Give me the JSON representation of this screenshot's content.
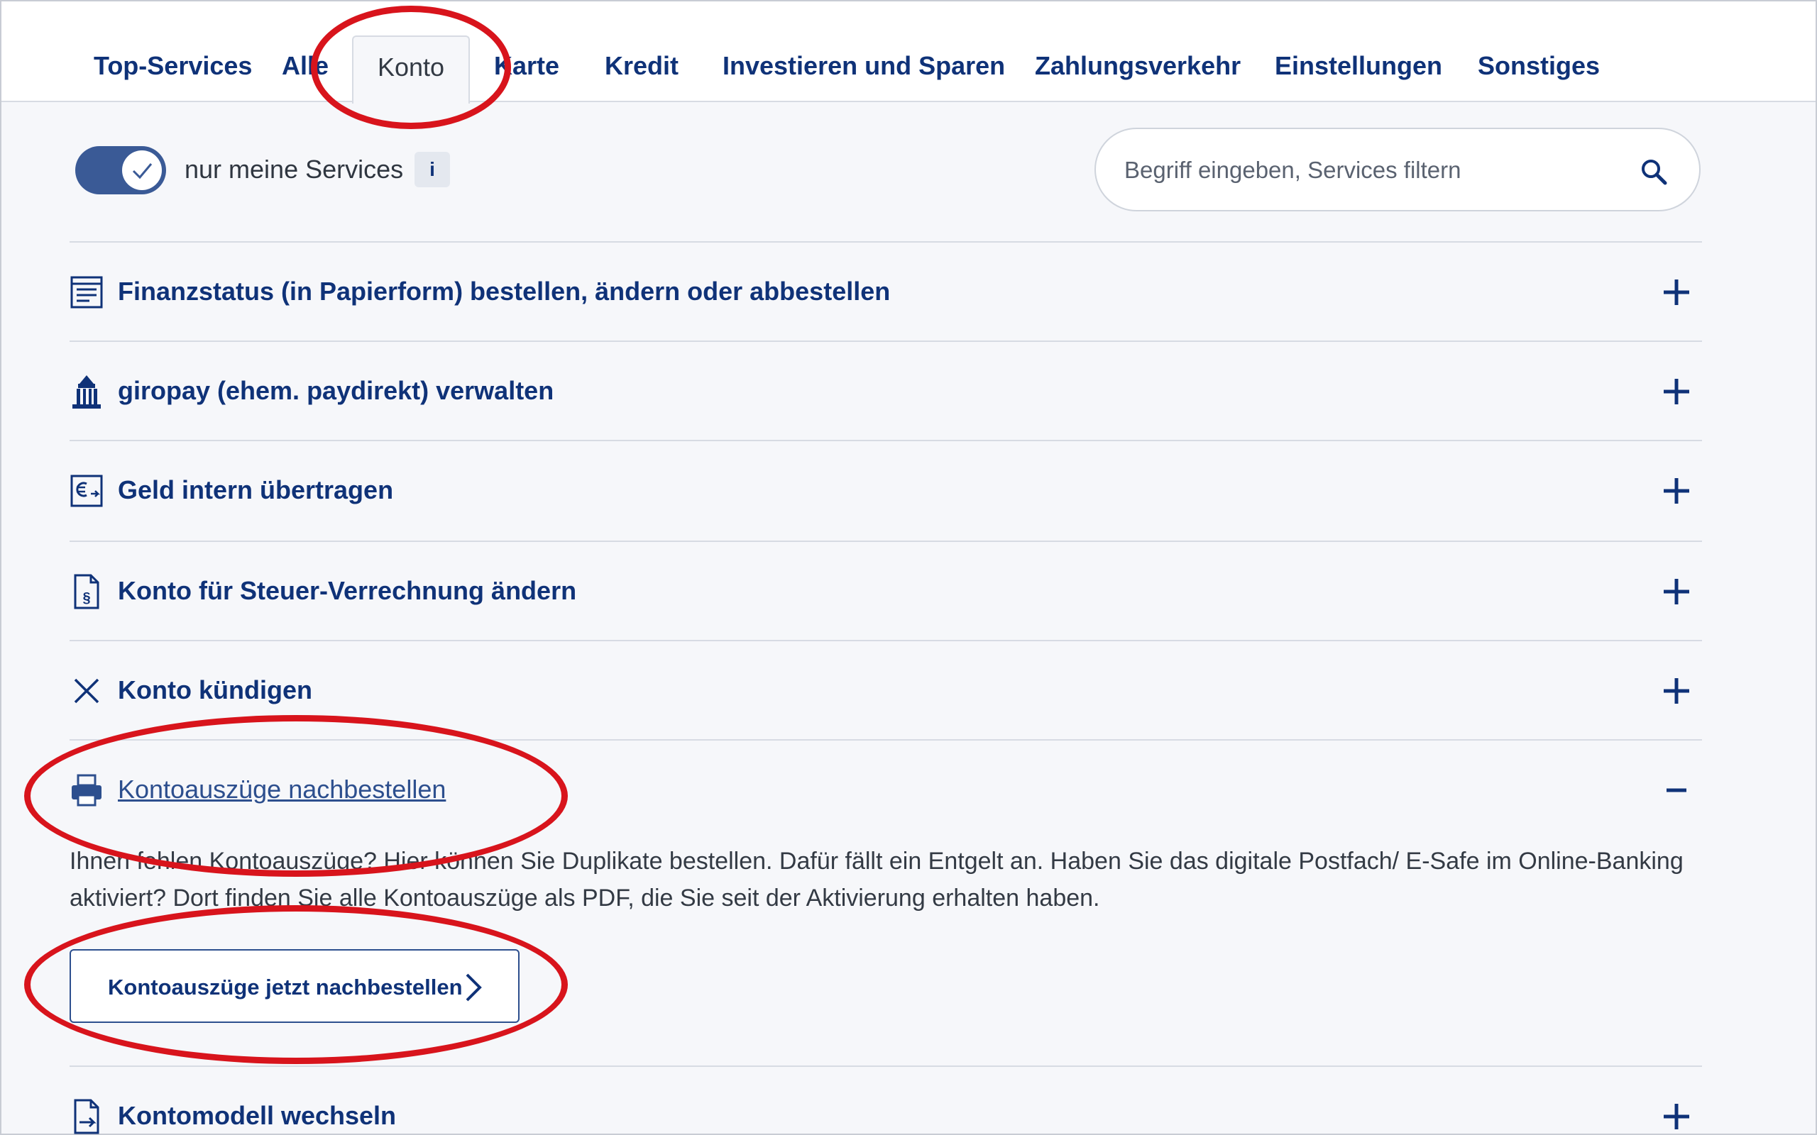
{
  "tabs": {
    "top_services": "Top-Services",
    "alle": "Alle",
    "konto": "Konto",
    "karte": "Karte",
    "kredit": "Kredit",
    "investieren": "Investieren und Sparen",
    "zahlungsverkehr": "Zahlungsverkehr",
    "einstellungen": "Einstellungen",
    "sonstiges": "Sonstiges",
    "active": "Konto"
  },
  "filter": {
    "toggle_label": "nur meine Services",
    "toggle_on": true,
    "info_label": "i",
    "search_placeholder": "Begriff eingeben, Services filtern"
  },
  "services": [
    {
      "label": "Finanzstatus (in Papierform) bestellen, ändern oder abbestellen",
      "icon": "document-list-icon",
      "expanded": false
    },
    {
      "label": "giropay (ehem. paydirekt) verwalten",
      "icon": "bank-building-icon",
      "expanded": false
    },
    {
      "label": "Geld intern übertragen",
      "icon": "euro-transfer-icon",
      "expanded": false
    },
    {
      "label": "Konto für Steuer-Verrechnung ändern",
      "icon": "tax-document-icon",
      "expanded": false
    },
    {
      "label": "Konto kündigen",
      "icon": "close-x-icon",
      "expanded": false
    },
    {
      "label": "Kontoauszüge nachbestellen",
      "icon": "printer-icon",
      "expanded": true
    },
    {
      "label": "Kontomodell wechseln",
      "icon": "document-arrow-icon",
      "expanded": false
    }
  ],
  "expanded": {
    "description": "Ihnen fehlen Kontoauszüge? Hier können Sie Duplikate bestellen. Dafür fällt ein Entgelt an. Haben Sie das digitale Postfach/ E-Safe im Online-Banking aktiviert? Dort finden Sie alle Kontoauszüge als PDF, die Sie seit der Aktivierung erhalten haben.",
    "cta_label": "Kontoauszüge jetzt nachbestellen"
  },
  "colors": {
    "brand_blue": "#0f3278",
    "annotation_red": "#d8141c",
    "background": "#f6f7fa"
  }
}
